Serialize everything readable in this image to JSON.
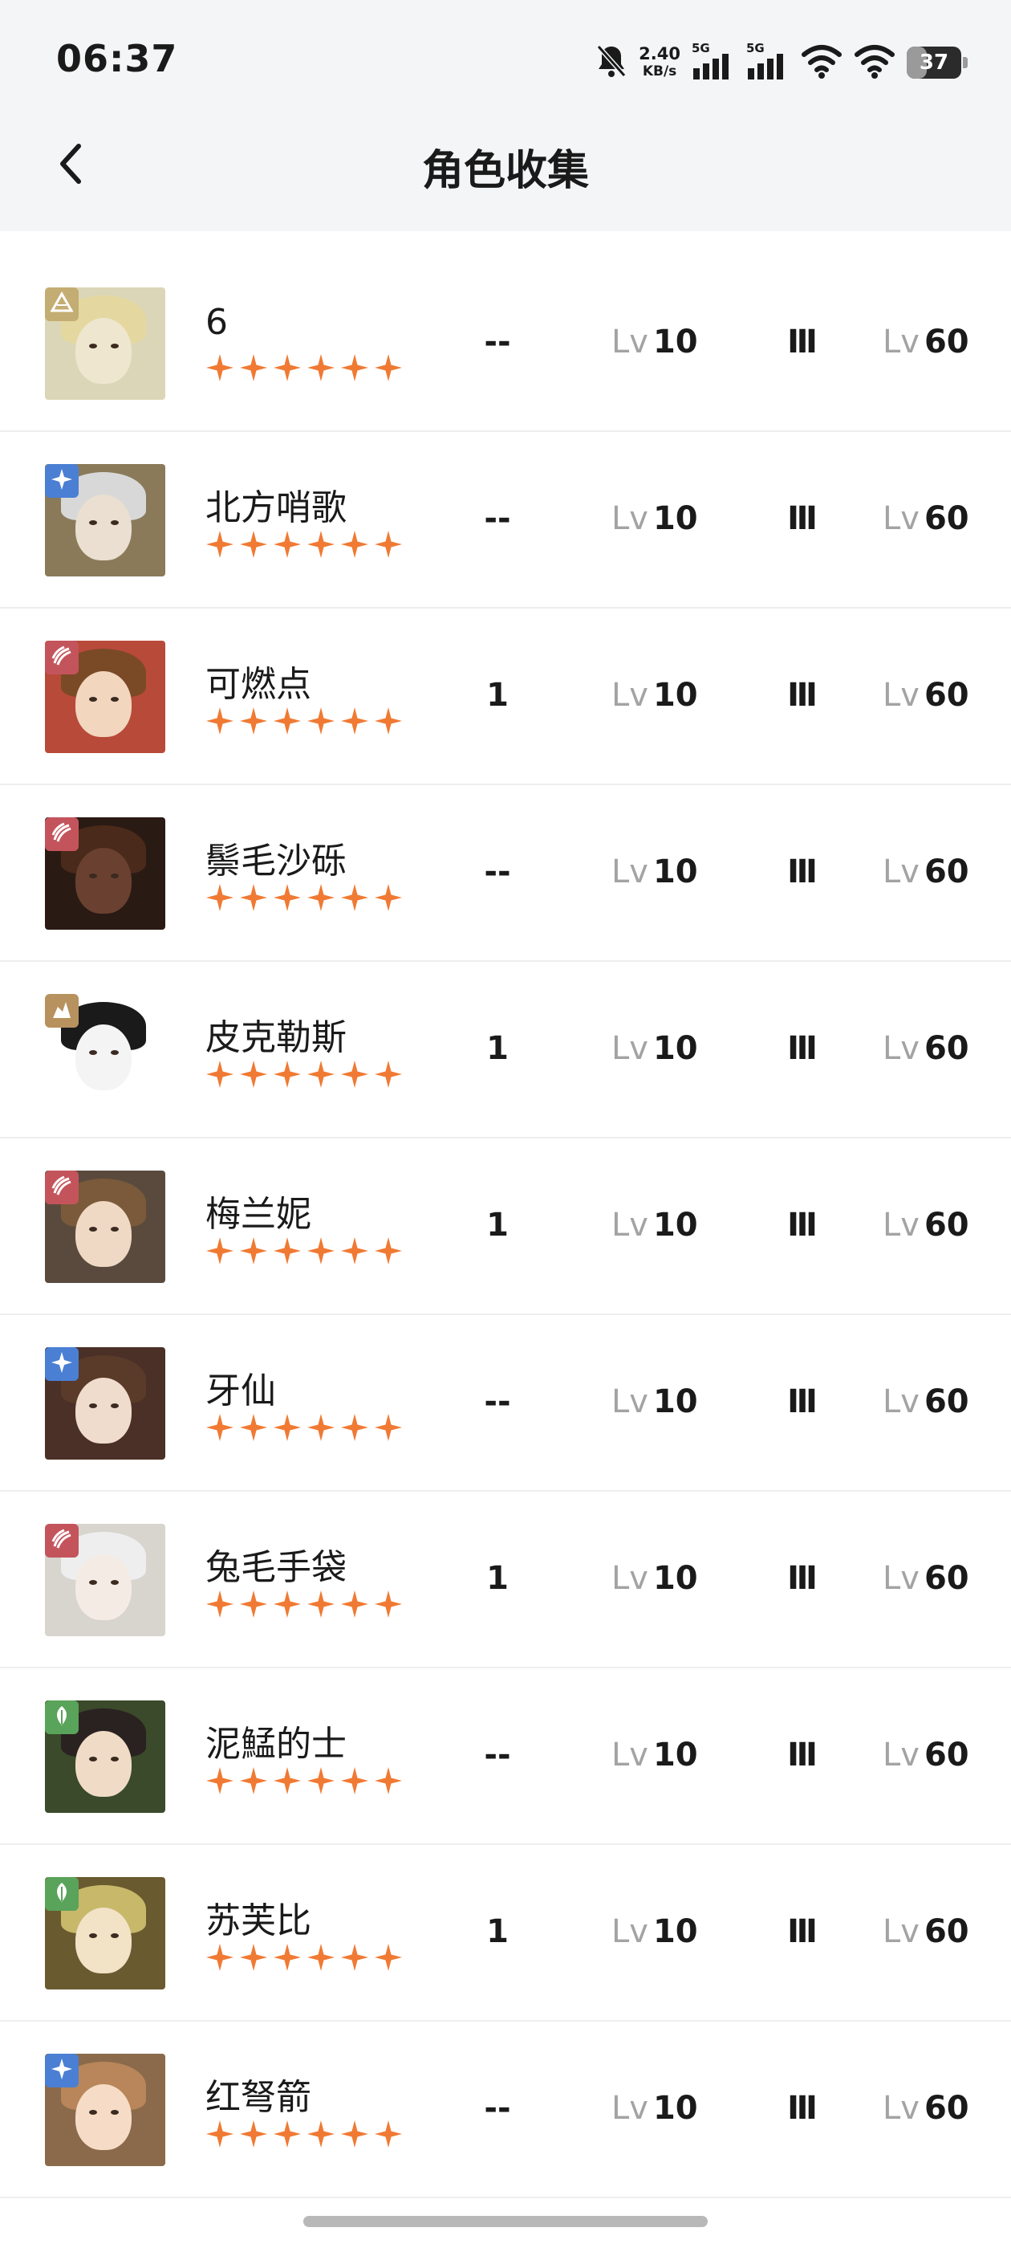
{
  "status_bar": {
    "time": "06:37",
    "net_speed": "2.40",
    "net_speed_unit": "KB/s",
    "signal_1_label": "5G",
    "signal_2_label": "5G",
    "battery": "37",
    "battery_level": 0.37
  },
  "header": {
    "title": "角色收集"
  },
  "colors": {
    "star": "#f07a33",
    "air": "#c4ad72",
    "beast": "#4a7fd4",
    "star_element": "#c4545c",
    "mineral": "#b7915e",
    "plant": "#5aa35a"
  },
  "characters": [
    {
      "name": "6",
      "element_icon": "pyramid-icon",
      "element_color": "#c4ad72",
      "stars": 6,
      "copies": "--",
      "lv_prefix": "Lv",
      "level": "10",
      "rank": "Ⅲ",
      "max_lv_prefix": "Lv",
      "max_level": "60",
      "palette": {
        "bg": "#dcd6b8",
        "hair": "#e4d8a0",
        "skin": "#efe6d0"
      }
    },
    {
      "name": "北方哨歌",
      "element_icon": "spark-icon",
      "element_color": "#4a7fd4",
      "stars": 6,
      "copies": "--",
      "lv_prefix": "Lv",
      "level": "10",
      "rank": "Ⅲ",
      "max_lv_prefix": "Lv",
      "max_level": "60",
      "palette": {
        "bg": "#8a7a5a",
        "hair": "#d8d8d8",
        "skin": "#eadfd0"
      }
    },
    {
      "name": "可燃点",
      "element_icon": "claw-icon",
      "element_color": "#c4545c",
      "stars": 6,
      "copies": "1",
      "lv_prefix": "Lv",
      "level": "10",
      "rank": "Ⅲ",
      "max_lv_prefix": "Lv",
      "max_level": "60",
      "palette": {
        "bg": "#b84a3a",
        "hair": "#7a4a26",
        "skin": "#f2d6be"
      }
    },
    {
      "name": "鬃毛沙砾",
      "element_icon": "claw-icon",
      "element_color": "#c4545c",
      "stars": 6,
      "copies": "--",
      "lv_prefix": "Lv",
      "level": "10",
      "rank": "Ⅲ",
      "max_lv_prefix": "Lv",
      "max_level": "60",
      "palette": {
        "bg": "#2a1a14",
        "hair": "#4a2a1a",
        "skin": "#6a4030"
      }
    },
    {
      "name": "皮克勒斯",
      "element_icon": "rock-icon",
      "element_color": "#b7915e",
      "stars": 6,
      "copies": "1",
      "lv_prefix": "Lv",
      "level": "10",
      "rank": "Ⅲ",
      "max_lv_prefix": "Lv",
      "max_level": "60",
      "palette": {
        "bg": "#ffffff",
        "hair": "#1a1a1a",
        "skin": "#f4f4f4"
      }
    },
    {
      "name": "梅兰妮",
      "element_icon": "claw-icon",
      "element_color": "#c4545c",
      "stars": 6,
      "copies": "1",
      "lv_prefix": "Lv",
      "level": "10",
      "rank": "Ⅲ",
      "max_lv_prefix": "Lv",
      "max_level": "60",
      "palette": {
        "bg": "#5a4a3e",
        "hair": "#7a5a3a",
        "skin": "#efd8c4"
      }
    },
    {
      "name": "牙仙",
      "element_icon": "spark-icon",
      "element_color": "#4a7fd4",
      "stars": 6,
      "copies": "--",
      "lv_prefix": "Lv",
      "level": "10",
      "rank": "Ⅲ",
      "max_lv_prefix": "Lv",
      "max_level": "60",
      "palette": {
        "bg": "#4a3026",
        "hair": "#5a3a28",
        "skin": "#f0dccc"
      }
    },
    {
      "name": "兔毛手袋",
      "element_icon": "claw-icon",
      "element_color": "#c4545c",
      "stars": 6,
      "copies": "1",
      "lv_prefix": "Lv",
      "level": "10",
      "rank": "Ⅲ",
      "max_lv_prefix": "Lv",
      "max_level": "60",
      "palette": {
        "bg": "#d8d4ce",
        "hair": "#eeeeee",
        "skin": "#f4ece4"
      }
    },
    {
      "name": "泥鯭的士",
      "element_icon": "leaf-icon",
      "element_color": "#5aa35a",
      "stars": 6,
      "copies": "--",
      "lv_prefix": "Lv",
      "level": "10",
      "rank": "Ⅲ",
      "max_lv_prefix": "Lv",
      "max_level": "60",
      "palette": {
        "bg": "#3a4a2a",
        "hair": "#2a2220",
        "skin": "#f0dcc6"
      }
    },
    {
      "name": "苏芙比",
      "element_icon": "leaf-icon",
      "element_color": "#5aa35a",
      "stars": 6,
      "copies": "1",
      "lv_prefix": "Lv",
      "level": "10",
      "rank": "Ⅲ",
      "max_lv_prefix": "Lv",
      "max_level": "60",
      "palette": {
        "bg": "#6a5a30",
        "hair": "#c8b86a",
        "skin": "#f2e2c6"
      }
    },
    {
      "name": "红弩箭",
      "element_icon": "spark-icon",
      "element_color": "#4a7fd4",
      "stars": 6,
      "copies": "--",
      "lv_prefix": "Lv",
      "level": "10",
      "rank": "Ⅲ",
      "max_lv_prefix": "Lv",
      "max_level": "60",
      "palette": {
        "bg": "#8a6a4a",
        "hair": "#b8865a",
        "skin": "#f6dcc6"
      }
    }
  ]
}
